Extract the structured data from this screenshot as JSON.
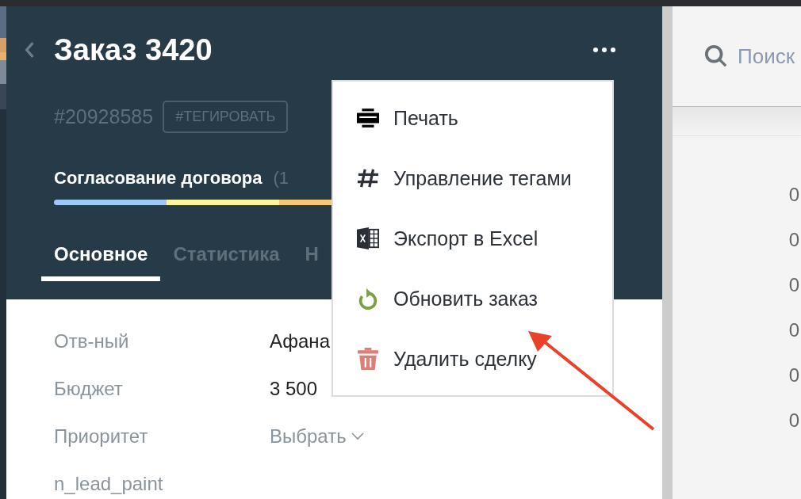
{
  "deal": {
    "title": "Заказ 3420",
    "id": "#20928585",
    "tag_button": "#ТЕГИРОВАТЬ",
    "stage": {
      "name": "Согласование договора",
      "count": "(1"
    },
    "stage_segments": [
      {
        "color": "#9fc8f5"
      },
      {
        "color": "#fdf59c"
      },
      {
        "color": "#f7c872"
      }
    ],
    "tabs": [
      {
        "label": "Основное",
        "selected": true
      },
      {
        "label": "Статистика",
        "selected": false
      },
      {
        "label": "Н",
        "selected": false
      }
    ],
    "fields": [
      {
        "label": "Отв-ный",
        "value": "Афана",
        "kind": "text"
      },
      {
        "label": "Бюджет",
        "value": "3 500",
        "kind": "text"
      },
      {
        "label": "Приоритет",
        "value": "Выбрать",
        "kind": "select"
      },
      {
        "label": "n_lead_paint"
      }
    ]
  },
  "menu": {
    "items": [
      {
        "label": "Печать",
        "kind": "print"
      },
      {
        "label": "Управление тегами",
        "kind": "tags"
      },
      {
        "label": "Экспорт в Excel",
        "kind": "excel"
      },
      {
        "label": "Обновить заказ",
        "kind": "refresh"
      },
      {
        "label": "Удалить сделку",
        "kind": "delete"
      }
    ]
  },
  "right_panel": {
    "search": {
      "placeholder": "Поиск"
    },
    "rows": [
      "0",
      "0",
      "0",
      "0",
      "0",
      "0"
    ]
  }
}
